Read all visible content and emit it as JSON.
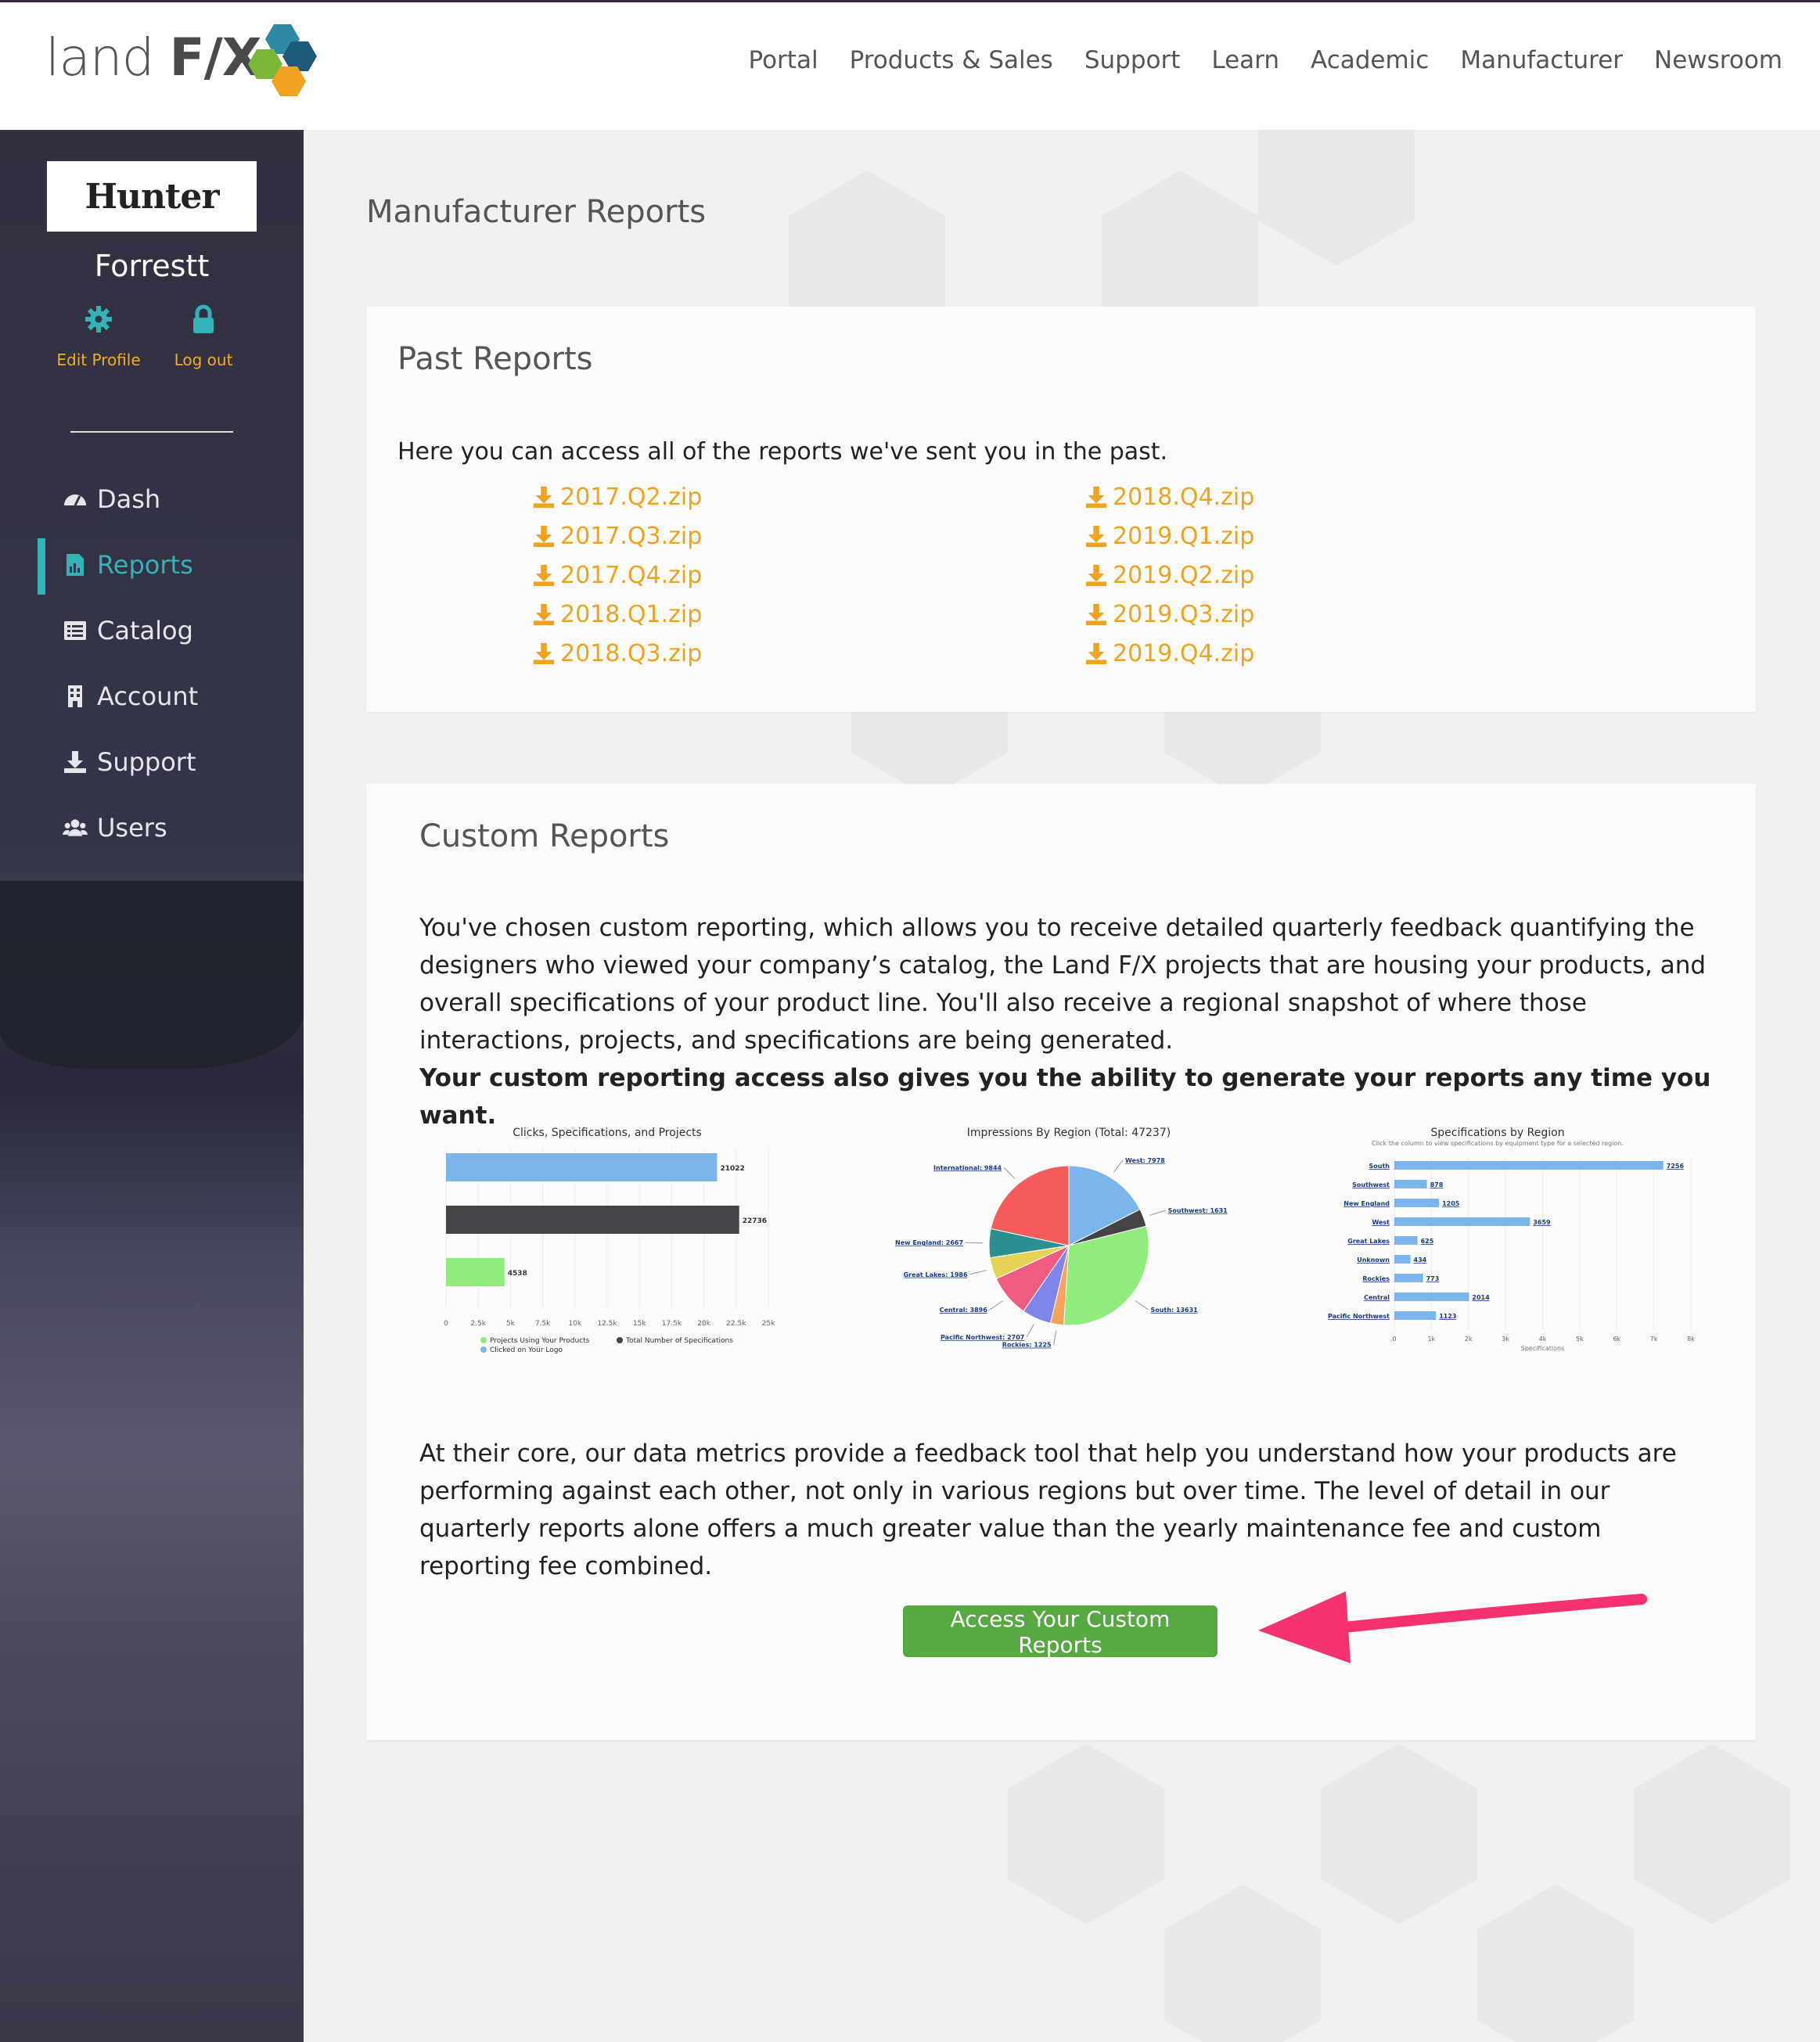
{
  "header": {
    "logo_text_light": "land ",
    "logo_text_bold": "F/X",
    "nav": [
      "Portal",
      "Products & Sales",
      "Support",
      "Learn",
      "Academic",
      "Manufacturer",
      "Newsroom"
    ]
  },
  "sidebar": {
    "brand": "Hunter",
    "user_name": "Forrestt",
    "edit_profile": "Edit Profile",
    "log_out": "Log out",
    "menu": [
      {
        "label": "Dash",
        "icon": "dashboard-icon"
      },
      {
        "label": "Reports",
        "icon": "report-icon",
        "active": true
      },
      {
        "label": "Catalog",
        "icon": "catalog-icon"
      },
      {
        "label": "Account",
        "icon": "building-icon"
      },
      {
        "label": "Support",
        "icon": "download-icon"
      },
      {
        "label": "Users",
        "icon": "users-icon"
      }
    ]
  },
  "main": {
    "title": "Manufacturer Reports",
    "past": {
      "title": "Past Reports",
      "intro": "Here you can access all of the reports we've sent you in the past.",
      "col1": [
        "2017.Q2.zip",
        "2017.Q3.zip",
        "2017.Q4.zip",
        "2018.Q1.zip",
        "2018.Q3.zip"
      ],
      "col2": [
        "2018.Q4.zip",
        "2019.Q1.zip",
        "2019.Q2.zip",
        "2019.Q3.zip",
        "2019.Q4.zip"
      ]
    },
    "custom": {
      "title": "Custom Reports",
      "para1": "You've chosen custom reporting, which allows you to receive detailed quarterly feedback quantifying the designers who viewed your company’s catalog, the Land F/X projects that are housing your products, and overall specifications of your product line. You'll also receive a regional snapshot of where those interactions, projects, and specifications are being generated.",
      "para1_bold": "Your custom reporting access also gives you the ability to generate your reports any time you want.",
      "para2": "At their core, our data metrics provide a feedback tool that help you understand how your products are performing against each other, not only in various regions but over time. The level of detail in our quarterly reports alone offers a much greater value than the yearly maintenance fee and custom reporting fee combined.",
      "cta": "Access Your Custom Reports"
    }
  },
  "colors": {
    "accent_teal": "#34b3b7",
    "link_orange": "#f0a31e",
    "cta_green": "#56a841",
    "arrow_pink": "#f5326e"
  },
  "chart_data": [
    {
      "type": "bar",
      "title": "Clicks, Specifications, and Projects",
      "categories": [
        "Clicked on Your Logo",
        "Total Number of Specifications",
        "Projects Using Your Products"
      ],
      "values": [
        21022,
        22736,
        4538
      ],
      "colors": [
        "#7cb5ec",
        "#434348",
        "#90ed7d"
      ],
      "xticks": [
        "0",
        "2.5k",
        "5k",
        "7.5k",
        "10k",
        "12.5k",
        "15k",
        "17.5k",
        "20k",
        "22.5k",
        "25k"
      ],
      "xlim": [
        0,
        25000
      ],
      "legend": [
        "Projects Using Your Products",
        "Total Number of Specifications",
        "Clicked on Your Logo"
      ]
    },
    {
      "type": "pie",
      "title": "Impressions By Region (Total: 47237)",
      "slices": [
        {
          "label": "West: 7978",
          "value": 7978,
          "color": "#7cb5ec"
        },
        {
          "label": "Southwest: 1631",
          "value": 1631,
          "color": "#434348"
        },
        {
          "label": "South: 13631",
          "value": 13631,
          "color": "#90ed7d"
        },
        {
          "label": "Rockies: 1225",
          "value": 1225,
          "color": "#f7a35c"
        },
        {
          "label": "Pacific Northwest: 2707",
          "value": 2707,
          "color": "#8085e9"
        },
        {
          "label": "Central: 3896",
          "value": 3896,
          "color": "#f15c80"
        },
        {
          "label": "Great Lakes: 1986",
          "value": 1986,
          "color": "#e4d354"
        },
        {
          "label": "New England: 2667",
          "value": 2667,
          "color": "#2b908f"
        },
        {
          "label": "International: 9844",
          "value": 9844,
          "color": "#f45b5b"
        }
      ]
    },
    {
      "type": "bar",
      "title": "Specifications by Region",
      "subtitle": "Click the column to view specifications by equipment type for a selected region.",
      "categories": [
        "South",
        "Southwest",
        "New England",
        "West",
        "Great Lakes",
        "Unknown",
        "Rockies",
        "Central",
        "Pacific Northwest"
      ],
      "values": [
        7256,
        878,
        1205,
        3659,
        625,
        434,
        773,
        2014,
        1123
      ],
      "color": "#7cb5ec",
      "xticks": [
        "0",
        "1k",
        "2k",
        "3k",
        "4k",
        "5k",
        "6k",
        "7k",
        "8k"
      ],
      "xlim": [
        0,
        8000
      ],
      "xlabel": "Specifications"
    }
  ]
}
